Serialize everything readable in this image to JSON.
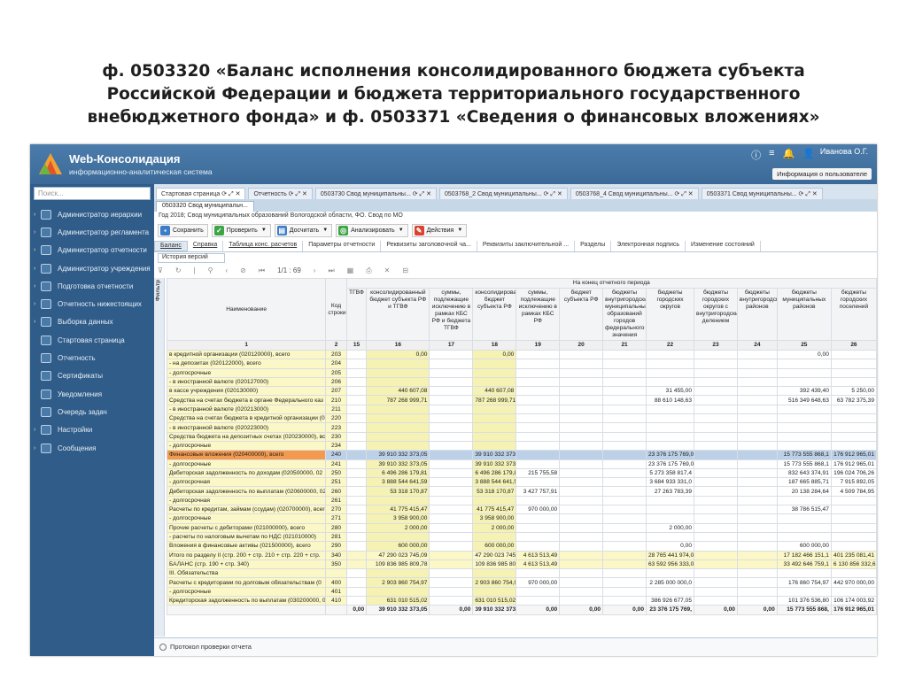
{
  "slide_title": "ф. 0503320 «Баланс исполнения консолидированного бюджета субъекта Российской Федерации и бюджета территориального государственного внебюджетного фонда» и ф. 0503371 «Сведения о финансовых вложениях»",
  "app": {
    "name": "Web-Консолидация",
    "subtitle": "информационно-аналитическая система",
    "user": "Иванова О.Г.",
    "user_info_button": "Информация о пользователе"
  },
  "sidebar": {
    "search_placeholder": "Поиск...",
    "items": [
      {
        "label": "Администратор иерархии",
        "icon": "hierarchy-icon",
        "arrow": true
      },
      {
        "label": "Администратор регламента",
        "icon": "regulation-icon",
        "arrow": true
      },
      {
        "label": "Администратор отчетности",
        "icon": "report-admin-icon",
        "arrow": true
      },
      {
        "label": "Администратор учреждения",
        "icon": "institution-icon",
        "arrow": true
      },
      {
        "label": "Подготовка отчетности",
        "icon": "prepare-icon",
        "arrow": true
      },
      {
        "label": "Отчетность нижестоящих",
        "icon": "subordinate-icon",
        "arrow": true
      },
      {
        "label": "Выборка данных",
        "icon": "data-selection-icon",
        "arrow": true
      },
      {
        "label": "Стартовая страница",
        "icon": "home-icon",
        "arrow": false
      },
      {
        "label": "Отчетность",
        "icon": "reports-icon",
        "arrow": false
      },
      {
        "label": "Сертификаты",
        "icon": "certificate-icon",
        "arrow": false
      },
      {
        "label": "Уведомления",
        "icon": "notification-icon",
        "arrow": false
      },
      {
        "label": "Очередь задач",
        "icon": "task-queue-icon",
        "arrow": false
      },
      {
        "label": "Настройки",
        "icon": "settings-icon",
        "arrow": true
      },
      {
        "label": "Сообщения",
        "icon": "messages-icon",
        "arrow": true
      }
    ]
  },
  "tabs_top": [
    "Стартовая страница",
    "Отчетность",
    "0503730 Свод муниципальны...",
    "0503768_2 Свод муниципальны...",
    "0503768_4 Свод муниципальны...",
    "0503371 Свод муниципальны..."
  ],
  "tab_active": "0503320 Свод муниципальн...",
  "doc_caption": "Год 2018; Свод муниципальных образований Вологодской области, ФО. Свод по МО",
  "toolbar": {
    "save": "Сохранить",
    "check": "Проверить",
    "calculate": "Досчитать",
    "analyze": "Анализировать",
    "actions": "Действия"
  },
  "nav_tabs": [
    "Баланс",
    "Справка",
    "Таблица конс. расчетов",
    "Параметры отчетности",
    "Реквизиты заголовочной ча...",
    "Реквизиты заключительной ...",
    "Разделы",
    "Электронная подпись",
    "Изменение состояний"
  ],
  "history_tab": "История версий",
  "pager": "1/1 : 69",
  "filter_label": "Фильтр",
  "grid": {
    "col_name": "Наименование",
    "col_code": "Код строки",
    "period_header": "На конец отчетного периода",
    "col_headers": [
      "ТГВФ",
      "консолидированный бюджет субъекта РФ и ТГВФ",
      "суммы, подлежащие исключению в рамках КБС РФ и бюджета ТГВФ",
      "консолидированный бюджет субъекта РФ",
      "суммы, подлежащие исключению в рамках КБС РФ",
      "бюджет субъекта РФ",
      "бюджеты внутригородских муниципальных образований городов федерального значения",
      "бюджеты городских округов",
      "бюджеты городских округов с внутригородским делением",
      "бюджеты внутригородских районов",
      "бюджеты муниципальных районов",
      "бюджеты городских поселений"
    ],
    "col_numbers": [
      "1",
      "2",
      "15",
      "16",
      "17",
      "18",
      "19",
      "20",
      "21",
      "22",
      "23",
      "24",
      "25",
      "26"
    ],
    "rows": [
      {
        "name": "в кредитной организации (020120000), всего",
        "code": "203",
        "c16": "0,00",
        "c18": "0,00",
        "c19": "",
        "c22": "",
        "c25": "0,00",
        "c26": ""
      },
      {
        "name": "- на депозитах (020122000), всего",
        "code": "204",
        "c16": "",
        "c18": "",
        "c19": "",
        "c22": "",
        "c25": "",
        "c26": ""
      },
      {
        "name": "- долгосрочные",
        "code": "205",
        "c16": "",
        "c18": "",
        "c19": "",
        "c22": "",
        "c25": "",
        "c26": ""
      },
      {
        "name": "- в иностранной валюте (020127000)",
        "code": "206",
        "c16": "",
        "c18": "",
        "c19": "",
        "c22": "",
        "c25": "",
        "c26": ""
      },
      {
        "name": "в кассе учреждения (020130000)",
        "code": "207",
        "c16": "440 607,08",
        "c18": "440 607,08",
        "c19": "",
        "c22": "31 455,00",
        "c25": "392 439,40",
        "c26": "5 250,00"
      },
      {
        "name": "Средства на счетах бюджета в органе Федерального каз",
        "code": "210",
        "c16": "787 268 999,71",
        "c18": "787 268 999,71",
        "c19": "",
        "c22": "88 610 148,63",
        "c25": "516 349 648,63",
        "c26": "63 782 375,39"
      },
      {
        "name": "- в иностранной валюте (020213000)",
        "code": "211",
        "c16": "",
        "c18": "",
        "c19": "",
        "c22": "",
        "c25": "",
        "c26": ""
      },
      {
        "name": "Средства на счетах бюджета в кредитной организации (0",
        "code": "220",
        "c16": "",
        "c18": "",
        "c19": "",
        "c22": "",
        "c25": "",
        "c26": ""
      },
      {
        "name": "- в иностранной валюте (020223000)",
        "code": "223",
        "c16": "",
        "c18": "",
        "c19": "",
        "c22": "",
        "c25": "",
        "c26": ""
      },
      {
        "name": "Средства бюджета на депозитных счетах (020230000), всего",
        "code": "230",
        "c16": "",
        "c18": "",
        "c19": "",
        "c22": "",
        "c25": "",
        "c26": ""
      },
      {
        "name": "- долгосрочные",
        "code": "234",
        "c16": "",
        "c18": "",
        "c19": "",
        "c22": "",
        "c25": "",
        "c26": ""
      },
      {
        "name": "Финансовые вложения (020400000), всего",
        "code": "240",
        "c16": "39 910 332 373,05",
        "c18": "39 910 332 373,05",
        "c19": "",
        "c22": "23 376 175 769,0",
        "c25": "15 773 555 868,1",
        "c26": "176 912 965,01",
        "selected": true
      },
      {
        "name": "- долгосрочные",
        "code": "241",
        "c16": "39 910 332 373,05",
        "c18": "39 910 332 373,05",
        "c19": "",
        "c22": "23 376 175 769,0",
        "c25": "15 773 555 868,1",
        "c26": "176 912 965,01"
      },
      {
        "name": "Дебиторская задолженность по доходам (020500000, 02",
        "code": "250",
        "c16": "6 496 286 179,81",
        "c18": "6 496 286 179,81",
        "c19": "215 755,58",
        "c22": "5 273 358 817,4",
        "c25": "832 643 374,91",
        "c26": "196 024 706,26"
      },
      {
        "name": "- долгосрочная",
        "code": "251",
        "c16": "3 888 544 641,59",
        "c18": "3 888 544 641,59",
        "c19": "",
        "c22": "3 684 933 331,0",
        "c25": "187 665 885,71",
        "c26": "7 915 892,05"
      },
      {
        "name": "Дебиторская задолженность по выплатам (020600000, 02",
        "code": "260",
        "c16": "53 318 170,87",
        "c18": "53 318 170,87",
        "c19": "3 427 757,91",
        "c22": "27 263 783,39",
        "c25": "20 138 284,64",
        "c26": "4 509 784,95"
      },
      {
        "name": "- долгосрочная",
        "code": "261",
        "c16": "",
        "c18": "",
        "c19": "",
        "c22": "",
        "c25": "",
        "c26": ""
      },
      {
        "name": "Расчеты по кредитам, займам (ссудам) (020700000), всего",
        "code": "270",
        "c16": "41 775 415,47",
        "c18": "41 775 415,47",
        "c19": "970 000,00",
        "c22": "",
        "c25": "38 786 515,47",
        "c26": ""
      },
      {
        "name": "- долгосрочные",
        "code": "271",
        "c16": "3 958 900,00",
        "c18": "3 958 900,00",
        "c19": "",
        "c22": "",
        "c25": "",
        "c26": ""
      },
      {
        "name": "Прочие расчеты с дебиторами (021000000), всего",
        "code": "280",
        "c16": "2 000,00",
        "c18": "2 000,00",
        "c19": "",
        "c22": "2 000,00",
        "c25": "",
        "c26": ""
      },
      {
        "name": "- расчеты по налоговым вычетам по НДС (021010000)",
        "code": "281",
        "c16": "",
        "c18": "",
        "c19": "",
        "c22": "",
        "c25": "",
        "c26": ""
      },
      {
        "name": "Вложения в финансовые активы (021500000), всего",
        "code": "290",
        "c16": "600 000,00",
        "c18": "600 000,00",
        "c19": "",
        "c22": "0,00",
        "c25": "600 000,00",
        "c26": ""
      },
      {
        "name": "Итого по разделу II (стр. 200 + стр. 210 + стр. 220 + стр.",
        "code": "340",
        "c16": "47 290 023 745,09",
        "c18": "47 290 023 745,09",
        "c19": "4 613 513,49",
        "c22": "28 765 441 974,0",
        "c25": "17 182 466 151,1",
        "c26": "401 235 081,41",
        "yellow": true
      },
      {
        "name": "БАЛАНС (стр. 190 + стр. 340)",
        "code": "350",
        "c16": "109 836 985 809,78",
        "c18": "109 836 985 809,78",
        "c19": "4 613 513,49",
        "c22": "63 592 956 333,0",
        "c25": "33 492 646 759,1",
        "c26": "6 130 856 332,6",
        "yellow": true
      },
      {
        "name": "III. Обязательства",
        "code": "",
        "c16": "",
        "c18": "",
        "c19": "",
        "c22": "",
        "c25": "",
        "c26": ""
      },
      {
        "name": "Расчеты с кредиторами по долговым обязательствам (0",
        "code": "400",
        "c16": "2 903 860 754,97",
        "c18": "2 903 860 754,97",
        "c19": "970 000,00",
        "c22": "2 285 000 000,0",
        "c25": "176 860 754,97",
        "c26": "442 970 000,00"
      },
      {
        "name": "- долгосрочные",
        "code": "401",
        "c16": "",
        "c18": "",
        "c19": "",
        "c22": "",
        "c25": "",
        "c26": ""
      },
      {
        "name": "Кредиторская задолженность по выплатам (030200000, 0",
        "code": "410",
        "c16": "631 010 515,02",
        "c18": "631 010 515,02",
        "c19": "",
        "c22": "386 926 677,05",
        "c25": "101 376 536,80",
        "c26": "106 174 003,92"
      }
    ],
    "totals": {
      "c15": "0,00",
      "c16": "39 910 332 373,05",
      "c17": "0,00",
      "c18": "39 910 332 373,05",
      "c19": "0,00",
      "c20": "0,00",
      "c21": "0,00",
      "c22": "23 376 175 769,",
      "c23": "0,00",
      "c24": "0,00",
      "c25": "15 773 555 868,",
      "c26": "176 912 965,01"
    }
  },
  "protocol_label": "Протокол проверки отчета",
  "colors": {
    "header_bar": "#3e6d9b",
    "sidebar": "#2f5c89",
    "selected_row": "#bcd0e8",
    "selected_name": "#f39a4e",
    "highlight_column": "#f5f2b4"
  }
}
